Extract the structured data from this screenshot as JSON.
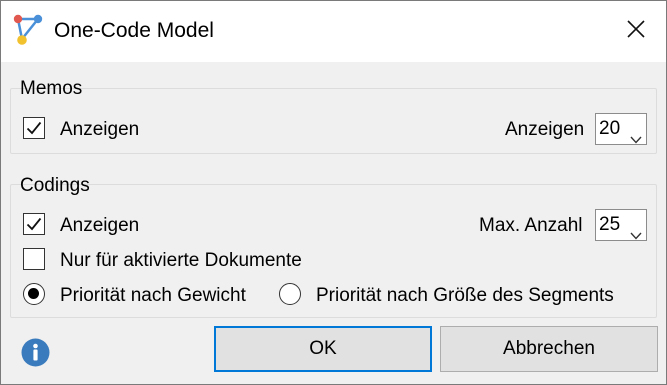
{
  "window": {
    "title": "One-Code Model"
  },
  "memos": {
    "group_label": "Memos",
    "show_checkbox": {
      "label": "Anzeigen",
      "checked": true
    },
    "count_label": "Anzeigen",
    "count_value": "20"
  },
  "codings": {
    "group_label": "Codings",
    "show_checkbox": {
      "label": "Anzeigen",
      "checked": true
    },
    "max_label": "Max. Anzahl",
    "max_value": "25",
    "only_activated": {
      "label": "Nur für aktivierte Dokumente",
      "checked": false
    },
    "priority_weight": {
      "label": "Priorität nach Gewicht",
      "selected": true
    },
    "priority_size": {
      "label": "Priorität nach Größe des Segments",
      "selected": false
    }
  },
  "buttons": {
    "ok": "OK",
    "cancel": "Abbrechen"
  },
  "icons": {
    "app": "app-node-graph-icon",
    "close": "close-icon",
    "info": "info-icon",
    "chevron": "chevron-down-icon",
    "check": "check-icon"
  },
  "colors": {
    "accent": "#0078d7",
    "info": "#3a7bbd",
    "app_icon_blue": "#4a90d9",
    "app_icon_red": "#e0584f",
    "app_icon_yellow": "#f2c12e"
  }
}
